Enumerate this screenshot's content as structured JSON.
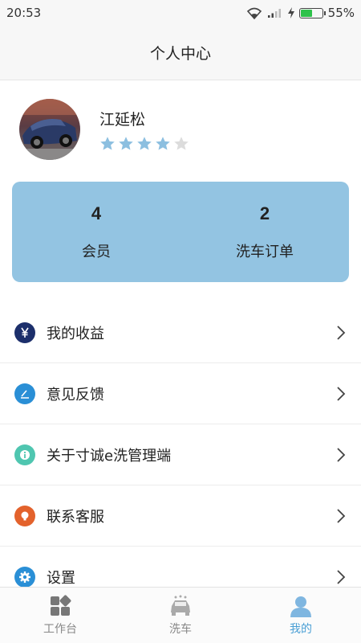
{
  "status_bar": {
    "time": "20:53",
    "battery": "55%",
    "battery_level": 0.55
  },
  "header": {
    "title": "个人中心"
  },
  "profile": {
    "name": "江延松",
    "rating": 4,
    "rating_max": 5
  },
  "stats": [
    {
      "value": "4",
      "label": "会员"
    },
    {
      "value": "2",
      "label": "洗车订单"
    }
  ],
  "menu": [
    {
      "label": "我的收益",
      "icon": "yen-icon",
      "color": "#1c2f6b"
    },
    {
      "label": "意见反馈",
      "icon": "edit-icon",
      "color": "#2a8fd6"
    },
    {
      "label": "关于寸诚e洗管理端",
      "icon": "info-icon",
      "color": "#4fc6b0"
    },
    {
      "label": "联系客服",
      "icon": "customer-service-icon",
      "color": "#e3622c"
    },
    {
      "label": "设置",
      "icon": "gear-icon",
      "color": "#2a8fd6"
    }
  ],
  "tabs": [
    {
      "label": "工作台",
      "icon": "dashboard-icon",
      "active": false
    },
    {
      "label": "洗车",
      "icon": "car-wash-icon",
      "active": false
    },
    {
      "label": "我的",
      "icon": "user-icon",
      "active": true
    }
  ],
  "colors": {
    "accent": "#4a9fd5",
    "card": "#93c4e2",
    "star_on": "#8cbfe0",
    "star_off": "#dcdcdc"
  }
}
